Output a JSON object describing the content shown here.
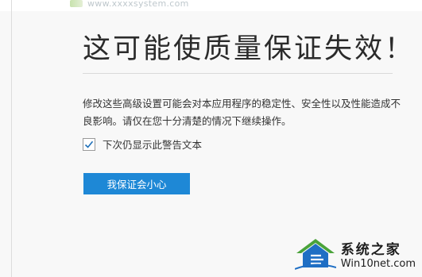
{
  "header": {
    "site_logo_text": "www.xxxxsystem.com"
  },
  "dialog": {
    "title": "这可能使质量保证失效！",
    "message": "修改这些高级设置可能会对本应用程序的稳定性、安全性以及性能造成不良影响。请仅在您十分清楚的情况下继续操作。",
    "checkbox": {
      "label": "下次仍显示此警告文本",
      "checked": true
    },
    "button_label": "我保证会小心"
  },
  "watermark": {
    "brand": "系统之家",
    "url": "Win10net.com"
  },
  "colors": {
    "accent": "#1e88d6",
    "background": "#f8f8f8",
    "text": "#333333"
  }
}
